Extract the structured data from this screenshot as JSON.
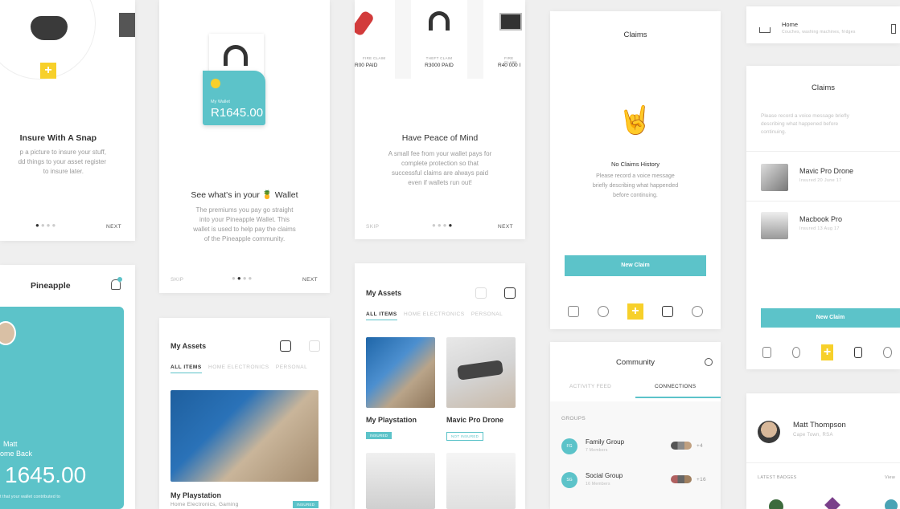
{
  "colors": {
    "accent": "#5cc3c9",
    "yellow": "#f7d02a"
  },
  "snap": {
    "title": "Insure With A Snap",
    "body1": "p a picture to insure your stuff,",
    "body2": "dd things to your asset register",
    "body3": "to insure later.",
    "next": "NEXT"
  },
  "wallet_intro": {
    "wallet_label": "My Wallet",
    "wallet_amount": "R1645.00",
    "title": "See what's in your 🍍 Wallet",
    "body1": "The premiums you pay go straight",
    "body2": "into your Pineapple Wallet. This",
    "body3": "wallet is used to help pay the claims",
    "body4": "of the Pineapple community.",
    "skip": "SKIP",
    "next": "NEXT"
  },
  "peace": {
    "item1": "R00 PAID",
    "item2_label": "THEFT CLAIM",
    "item2": "R3000 PAID",
    "item3": "R40 000 I",
    "item1_label": "FIRE CLAIM",
    "item3_label": "FIRE CLAIM",
    "title": "Have Peace of Mind",
    "body1": "A small fee from your wallet pays for",
    "body2": "complete protection so that",
    "body3": "successful claims are always paid",
    "body4": "even if wallets run out!",
    "skip": "SKIP",
    "next": "NEXT"
  },
  "claims_empty": {
    "title": "Claims",
    "empty_title": "No Claims History",
    "body1": "Please record a voice message",
    "body2": "briefly describing what happended",
    "body3": "before continuing.",
    "button": "New Claim",
    "emoji": "🤘"
  },
  "home_strip": {
    "label": "Home",
    "sub": "Couches, washing machines, fridges"
  },
  "claims_list": {
    "title": "Claims",
    "body1": "Please record a voice message briefly",
    "body2": "describing what happened before",
    "body3": "continuing.",
    "items": [
      {
        "name": "Mavic Pro Drone",
        "sub": "Insured 20 June 17"
      },
      {
        "name": "Macbook Pro",
        "sub": "Insured 13 Aug 17"
      }
    ],
    "button": "New Claim"
  },
  "pineapple_home": {
    "title": "Pineapple",
    "greet1": "Matt",
    "greet2": "ome Back",
    "amount": "1645.00",
    "note": "t that your wallet contributed to"
  },
  "assets_small": {
    "title": "My Assets",
    "tabs": [
      "ALL ITEMS",
      "HOME ELECTRONICS",
      "PERSONAL"
    ],
    "item": "My Playstation",
    "sub": "Home Electronics, Gaming",
    "badge": "INSURED"
  },
  "assets_grid": {
    "title": "My Assets",
    "tabs": [
      "ALL ITEMS",
      "HOME ELECTRONICS",
      "PERSONAL"
    ],
    "items": [
      {
        "name": "My Playstation",
        "badge": "INSURED"
      },
      {
        "name": "Mavic Pro Drone",
        "badge": "NOT INSURED"
      }
    ]
  },
  "community": {
    "title": "Community",
    "tabs": [
      "ACTIVITY FEED",
      "CONNECTIONS"
    ],
    "groups_label": "GROUPS",
    "groups": [
      {
        "initials": "FG",
        "name": "Family Group",
        "sub": "7 Members",
        "more": "+4"
      },
      {
        "initials": "SG",
        "name": "Social Group",
        "sub": "16 Members",
        "more": "+16"
      }
    ]
  },
  "profile": {
    "name": "Matt Thompson",
    "location": "Cape Town, RSA",
    "badges_label": "LATEST BADGES",
    "view_all": "View"
  }
}
